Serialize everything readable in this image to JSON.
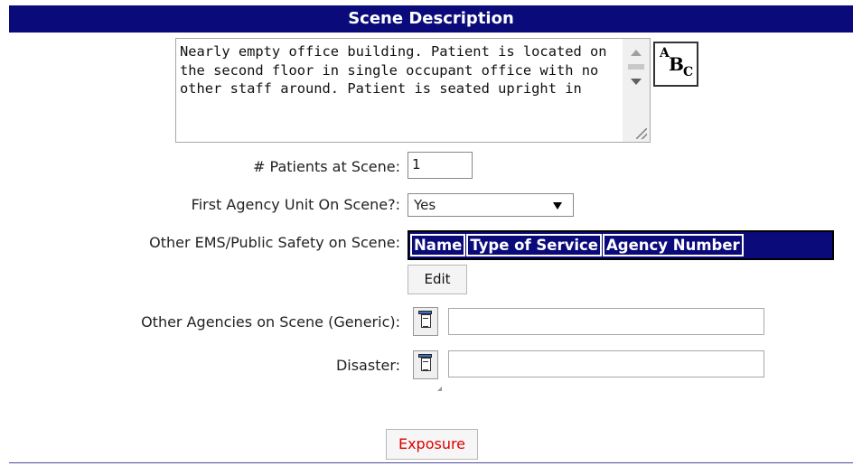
{
  "section": {
    "title": "Scene Description"
  },
  "scene_description": {
    "text": "Nearly empty office building. Patient is located on the second floor in single occupant office with no other staff around. Patient is seated upright in",
    "spellcheck_label_a": "A",
    "spellcheck_label_b": "B",
    "spellcheck_label_c": "C"
  },
  "fields": {
    "patients_label": "# Patients at Scene:",
    "patients_value": "1",
    "first_agency_label": "First Agency Unit On Scene?:",
    "first_agency_value": "Yes",
    "other_ems_label": "Other EMS/Public Safety on Scene:",
    "other_agencies_label": "Other Agencies on Scene (Generic):",
    "other_agencies_value": "",
    "disaster_label": "Disaster:",
    "disaster_value": ""
  },
  "agency_table": {
    "columns": [
      "Name",
      "Type of Service",
      "Agency Number"
    ]
  },
  "buttons": {
    "edit": "Edit",
    "exposure": "Exposure"
  },
  "colors": {
    "header_bg": "#0a0a7a",
    "exposure_text": "#e00000"
  }
}
